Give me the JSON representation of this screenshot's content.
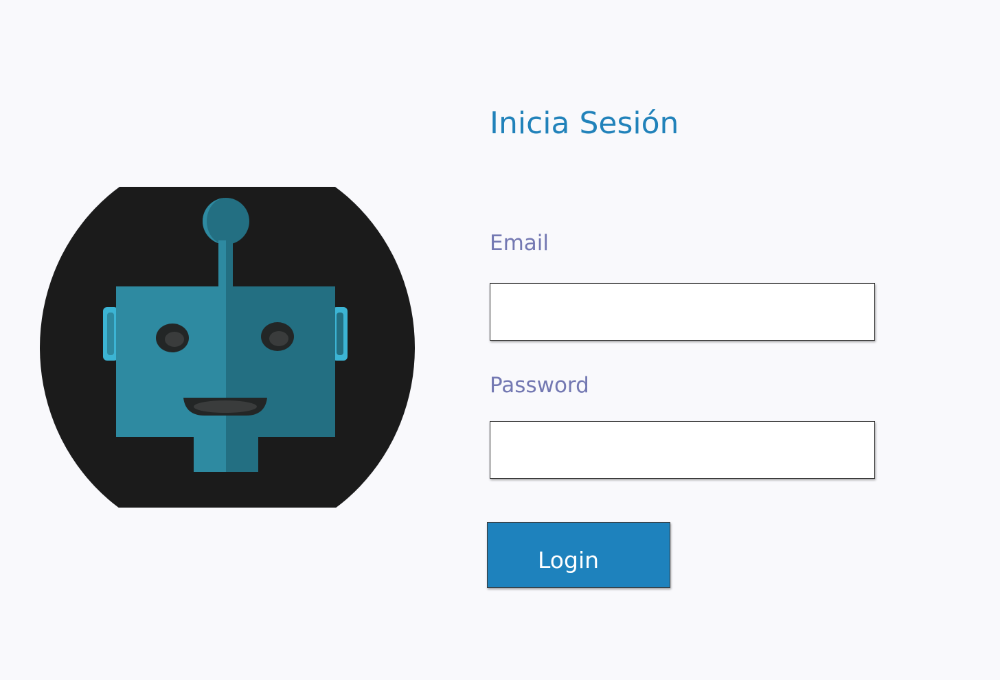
{
  "colors": {
    "background": "#f9f9fc",
    "title": "#2182ba",
    "label": "#7378b2",
    "button": "#1e82bd",
    "button_text": "#ffffff",
    "logo_circle": "#1b1b1b",
    "robot_light": "#2e8aa1",
    "robot_dark": "#236f82",
    "robot_ear": "#3cb4d4"
  },
  "logo": {
    "icon": "robot-face-icon"
  },
  "login_form": {
    "title": "Inicia Sesión",
    "email": {
      "label": "Email",
      "value": ""
    },
    "password": {
      "label": "Password",
      "value": ""
    },
    "submit_label": "Login"
  }
}
